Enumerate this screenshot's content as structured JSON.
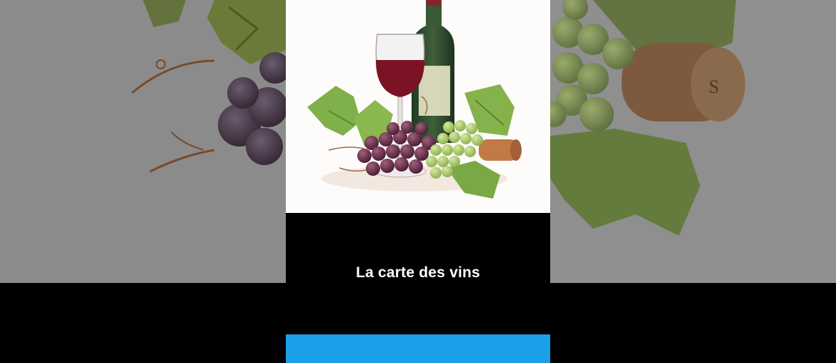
{
  "caption": {
    "text": "La carte des vins"
  },
  "colors": {
    "accent_bar": "#1aa0e8",
    "background": "#000000",
    "wine": "#7a1424",
    "bottle": "#2f4a2c",
    "grape_red": "#5a2440",
    "grape_green": "#a9c46a",
    "leaf": "#7fb04a",
    "cork": "#b86a3a"
  },
  "illustration": {
    "subject": "watercolor-wine-still-life",
    "elements": [
      "wine-bottle",
      "wine-glass",
      "red-grapes",
      "green-grapes",
      "grape-leaves",
      "cork"
    ]
  }
}
